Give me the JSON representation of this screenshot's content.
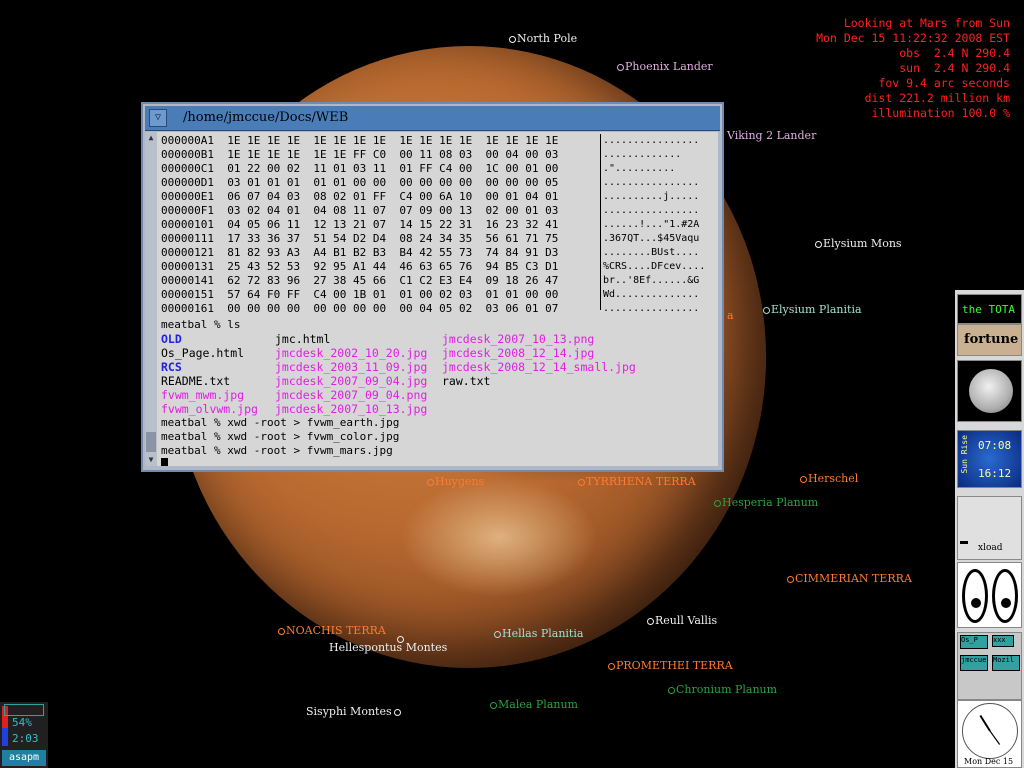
{
  "info": {
    "lines": [
      "Looking at Mars from Sun",
      "Mon Dec 15 11:22:32 2008 EST",
      "obs  2.4 N 290.4",
      "sun  2.4 N 290.4",
      "fov 9.4 arc seconds",
      "dist 221.2 million km",
      "illumination 100.0 %"
    ]
  },
  "mars_labels": [
    {
      "text": "North Pole",
      "color": "white"
    },
    {
      "text": "Phoenix Lander",
      "color": "pink"
    },
    {
      "text": "Viking 2 Lander",
      "color": "pink"
    },
    {
      "text": "Elysium Mons",
      "color": "white"
    },
    {
      "text": "Elysium Planitia",
      "color": "cyan"
    },
    {
      "text": "Herschel",
      "color": "orange"
    },
    {
      "text": "TYRRHENA TERRA",
      "color": "orange"
    },
    {
      "text": "Huygens",
      "color": "orange"
    },
    {
      "text": "Hesperia Planum",
      "color": "green"
    },
    {
      "text": "CIMMERIAN TERRA",
      "color": "orange"
    },
    {
      "text": "Reull Vallis",
      "color": "white"
    },
    {
      "text": "NOACHIS TERRA",
      "color": "orange"
    },
    {
      "text": "Hellas Planitia",
      "color": "cyan"
    },
    {
      "text": "Hellespontus Montes",
      "color": "white"
    },
    {
      "text": "PROMETHEI TERRA",
      "color": "orange"
    },
    {
      "text": "Chronium Planum",
      "color": "green"
    },
    {
      "text": "Sisyphi Montes",
      "color": "white"
    },
    {
      "text": "Malea Planum",
      "color": "green"
    },
    {
      "text": "a",
      "color": "orange"
    }
  ],
  "xterm": {
    "title": "/home/jmccue/Docs/WEB",
    "hex_rows": [
      "000000A1  1E 1E 1E 1E  1E 1E 1E 1E  1E 1E 1E 1E  1E 1E 1E 1E",
      "000000B1  1E 1E 1E 1E  1E 1E FF C0  00 11 08 03  00 04 00 03",
      "000000C1  01 22 00 02  11 01 03 11  01 FF C4 00  1C 00 01 00",
      "000000D1  03 01 01 01  01 01 00 00  00 00 00 00  00 00 00 05",
      "000000E1  06 07 04 03  08 02 01 FF  C4 00 6A 10  00 01 04 01",
      "000000F1  03 02 04 01  04 08 11 07  07 09 00 13  02 00 01 03",
      "00000101  04 05 06 11  12 13 21 07  14 15 22 31  16 23 32 41",
      "00000111  17 33 36 37  51 54 D2 D4  08 24 34 35  56 61 71 75",
      "00000121  81 82 93 A3  A4 B1 B2 B3  B4 42 55 73  74 84 91 D3",
      "00000131  25 43 52 53  92 95 A1 44  46 63 65 76  94 B5 C3 D1",
      "00000141  62 72 83 96  27 38 45 66  C1 C2 E3 E4  09 18 26 47",
      "00000151  57 64 F0 FF  C4 00 1B 01  01 00 02 03  01 01 00 00",
      "00000161  00 00 00 00  00 00 00 00  00 04 05 02  03 06 01 07"
    ],
    "ascii_rows": [
      "................",
      ".............",
      ".\"..........",
      "................",
      "..........j.....",
      "................",
      "......!...\"1.#2A",
      ".367QT...$45Vaqu",
      "........BUst....",
      "%CRS....DFcev....",
      "br..'8Ef......&G",
      "Wd..............",
      "................"
    ],
    "prompt_ls": "meatbal % ls",
    "ls_col1": [
      {
        "text": "OLD",
        "kind": "dir"
      },
      {
        "text": "Os_Page.html",
        "kind": "file"
      },
      {
        "text": "RCS",
        "kind": "dir"
      },
      {
        "text": "README.txt",
        "kind": "file"
      },
      {
        "text": "fvwm_mwm.jpg",
        "kind": "img"
      },
      {
        "text": "fvwm_olvwm.jpg",
        "kind": "img"
      }
    ],
    "ls_col2": [
      {
        "text": "jmc.html",
        "kind": "file"
      },
      {
        "text": "jmcdesk_2002_10_20.jpg",
        "kind": "img"
      },
      {
        "text": "jmcdesk_2003_11_09.jpg",
        "kind": "img"
      },
      {
        "text": "jmcdesk_2007_09_04.jpg",
        "kind": "img"
      },
      {
        "text": "jmcdesk_2007_09_04.png",
        "kind": "img"
      },
      {
        "text": "jmcdesk_2007_10_13.jpg",
        "kind": "img"
      }
    ],
    "ls_col3": [
      {
        "text": "jmcdesk_2007_10_13.png",
        "kind": "img"
      },
      {
        "text": "jmcdesk_2008_12_14.jpg",
        "kind": "img"
      },
      {
        "text": "jmcdesk_2008_12_14_small.jpg",
        "kind": "img"
      },
      {
        "text": "raw.txt",
        "kind": "file"
      }
    ],
    "cmds": [
      "meatbal % xwd -root > fvwm_earth.jpg",
      "meatbal % xwd -root > fvwm_color.jpg",
      "meatbal % xwd -root > fvwm_mars.jpg"
    ]
  },
  "dock": {
    "tota": "the TOTA",
    "fortune": "fortune",
    "sunrise_label": "Sun Rise",
    "sunrise_time": "07:08",
    "sunset_time": "16:12",
    "xload": "xload",
    "pager": [
      "Os_P",
      "xxx",
      "jmccue",
      "Mozil"
    ],
    "clock_date": "Mon Dec 15"
  },
  "monitor": {
    "percent": "54%",
    "time": "2:03",
    "host": "asapm"
  }
}
